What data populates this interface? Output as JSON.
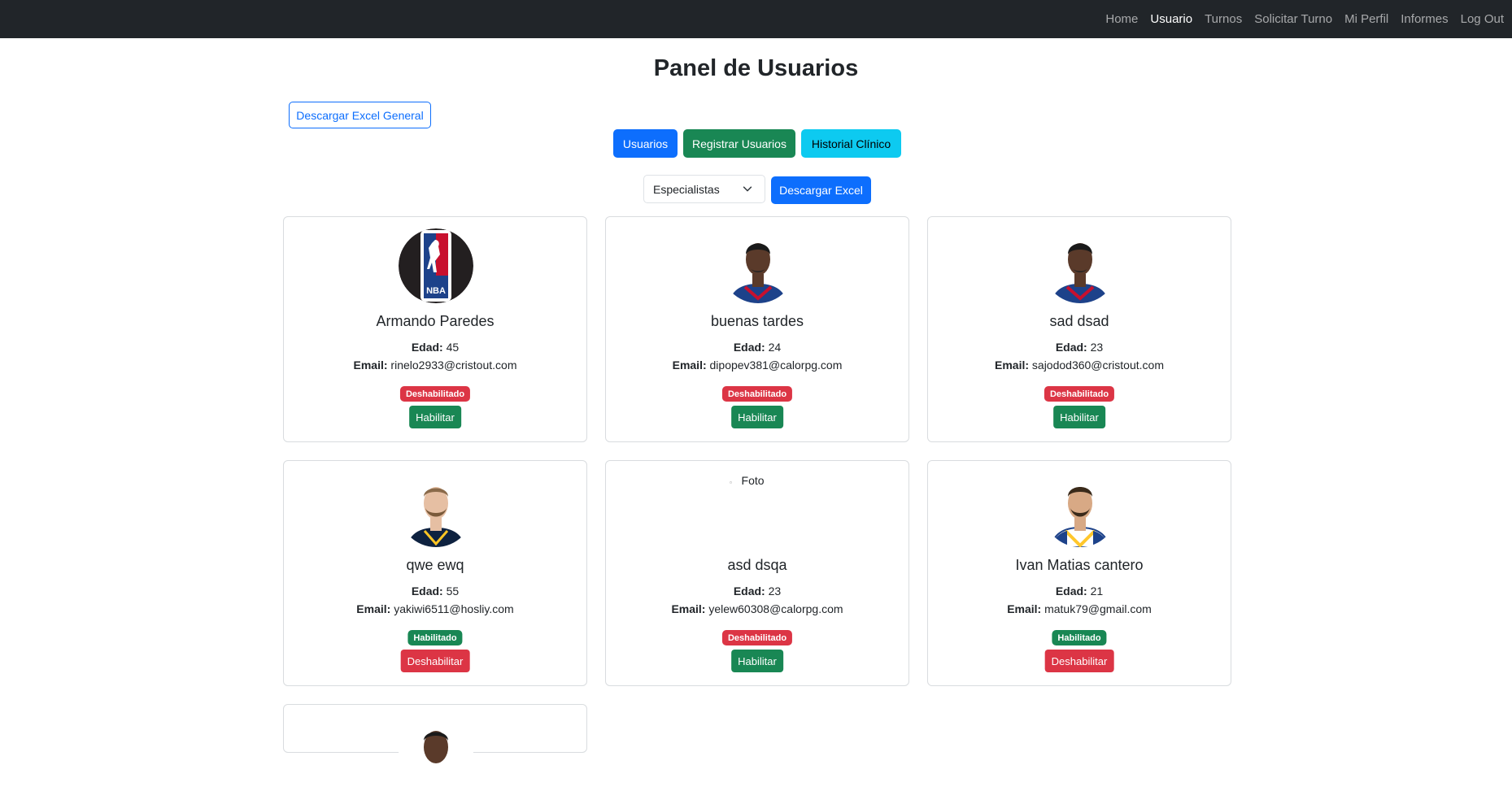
{
  "nav": {
    "links": [
      "Home",
      "Usuario",
      "Turnos",
      "Solicitar Turno",
      "Mi Perfil",
      "Informes",
      "Log Out"
    ],
    "active": "Usuario"
  },
  "page": {
    "title": "Panel de Usuarios"
  },
  "actions": {
    "download_general": "Descargar Excel General",
    "tab_usuarios": "Usuarios",
    "tab_registrar": "Registrar Usuarios",
    "tab_historial": "Historial Clínico",
    "filter_value": "Especialistas",
    "download_excel": "Descargar Excel"
  },
  "labels": {
    "edad": "Edad:",
    "email": "Email:"
  },
  "users": [
    {
      "name": "Armando Paredes",
      "age": "45",
      "email": "rinelo2933@cristout.com",
      "status": "Deshabilitado",
      "action": "Habilitar",
      "avatar": "nba-logo"
    },
    {
      "name": "buenas tardes",
      "age": "24",
      "email": "dipopev381@calorpg.com",
      "status": "Deshabilitado",
      "action": "Habilitar",
      "avatar": "player-photo"
    },
    {
      "name": "sad dsad",
      "age": "23",
      "email": "sajodod360@cristout.com",
      "status": "Deshabilitado",
      "action": "Habilitar",
      "avatar": "player-photo"
    },
    {
      "name": "qwe ewq",
      "age": "55",
      "email": "yakiwi6511@hosliy.com",
      "status": "Habilitado",
      "action": "Deshabilitar",
      "avatar": "player-photo"
    },
    {
      "name": "asd dsqa",
      "age": "23",
      "email": "yelew60308@calorpg.com",
      "status": "Deshabilitado",
      "action": "Habilitar",
      "avatar": "broken-image",
      "avatar_alt": "Foto"
    },
    {
      "name": "Ivan Matias cantero",
      "age": "21",
      "email": "matuk79@gmail.com",
      "status": "Habilitado",
      "action": "Deshabilitar",
      "avatar": "player-photo"
    }
  ],
  "colors": {
    "navbar": "#212529",
    "primary": "#0d6efd",
    "success": "#198754",
    "info": "#0dcaf0",
    "danger": "#dc3545"
  }
}
